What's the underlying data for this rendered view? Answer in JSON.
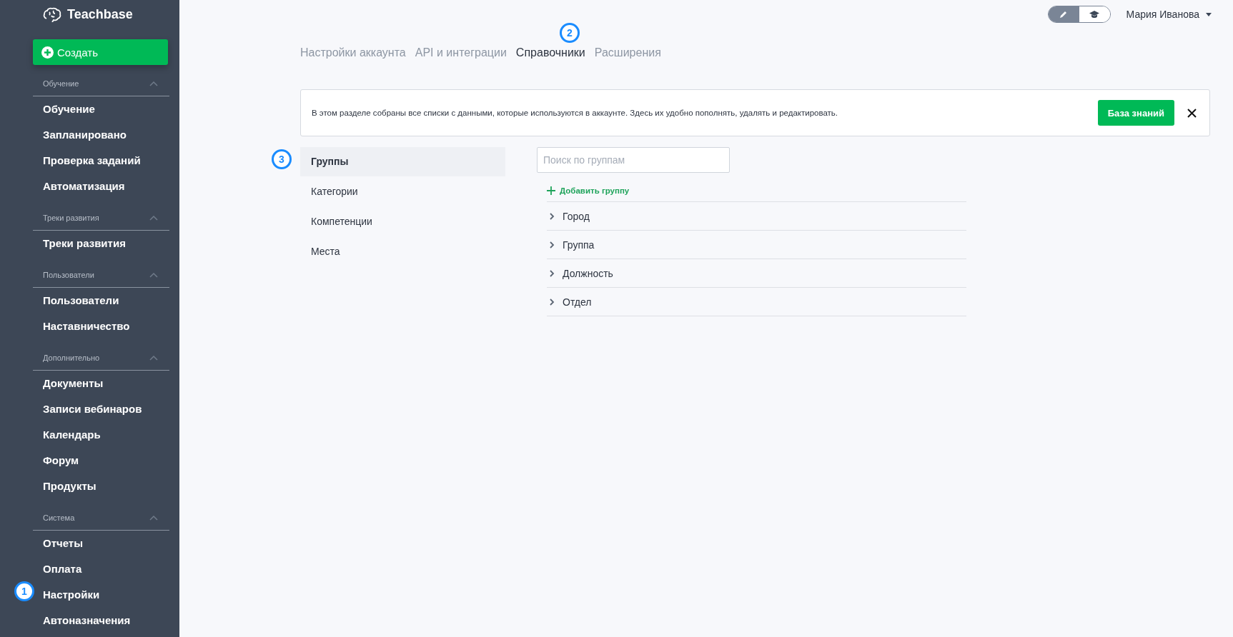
{
  "sidebar": {
    "logo": "Teachbase",
    "create_button": "Создать",
    "sections": [
      {
        "title": "Обучение",
        "expanded": true,
        "items": [
          "Обучение",
          "Запланировано",
          "Проверка заданий",
          "Автоматизация"
        ]
      },
      {
        "title": "Треки развития",
        "expanded": true,
        "items": [
          "Треки развития"
        ]
      },
      {
        "title": "Пользователи",
        "expanded": true,
        "items": [
          "Пользователи",
          "Наставничество"
        ]
      },
      {
        "title": "Дополнительно",
        "expanded": true,
        "items": [
          "Документы",
          "Записи вебинаров",
          "Календарь",
          "Форум",
          "Продукты"
        ]
      },
      {
        "title": "Система",
        "expanded": true,
        "items": [
          "Отчеты",
          "Оплата",
          "Настройки",
          "Автоназначения"
        ]
      }
    ]
  },
  "topbar": {
    "mode_toggle": [
      {
        "kind": "edit",
        "selected": true
      },
      {
        "kind": "learn",
        "selected": false
      }
    ],
    "user": "Мария Иванова"
  },
  "tabs": [
    {
      "label": "Настройки аккаунта",
      "selected": false
    },
    {
      "label": "API и интеграции",
      "selected": false
    },
    {
      "label": "Справочники",
      "selected": true
    },
    {
      "label": "Расширения",
      "selected": false
    }
  ],
  "notice": {
    "text": "В этом разделе собраны все списки с данными, которые используются в аккаунте. Здесь их удобно пополнять, удалять и редактировать.",
    "button": "База знаний"
  },
  "catalog_menu": [
    {
      "label": "Группы",
      "selected": true
    },
    {
      "label": "Категории",
      "selected": false
    },
    {
      "label": "Компетенции",
      "selected": false
    },
    {
      "label": "Места",
      "selected": false
    }
  ],
  "groups": {
    "search": {
      "placeholder": "Поиск по группам"
    },
    "add_button": "Добавить группу",
    "rows": [
      {
        "name": "Город",
        "expanded": false
      },
      {
        "name": "Группа",
        "expanded": false
      },
      {
        "name": "Должность",
        "expanded": false
      },
      {
        "name": "Отдел",
        "expanded": false
      }
    ]
  },
  "markers": [
    "1",
    "2",
    "3"
  ]
}
